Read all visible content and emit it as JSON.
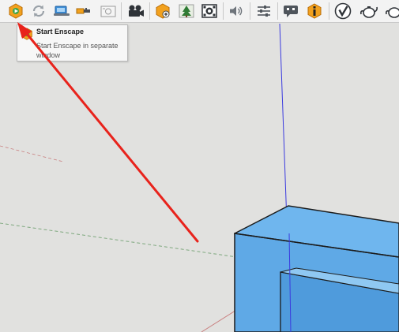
{
  "toolbar": {
    "buttons": [
      {
        "id": "start-enscape",
        "icon": "enscape-start-icon"
      },
      {
        "id": "sync-updates",
        "icon": "sync-icon"
      },
      {
        "id": "capture-screenshot",
        "icon": "screenshot-icon"
      },
      {
        "id": "export",
        "icon": "export-icon"
      },
      {
        "id": "render-image",
        "icon": "camera-icon"
      },
      {
        "id": "video-editor",
        "icon": "film-camera-icon"
      },
      {
        "id": "asset-library",
        "icon": "asset-library-icon"
      },
      {
        "id": "visual-settings",
        "icon": "tree-icon"
      },
      {
        "id": "panorama",
        "icon": "panorama-icon"
      },
      {
        "id": "sound",
        "icon": "speaker-icon"
      },
      {
        "id": "settings",
        "icon": "sliders-icon"
      },
      {
        "id": "feedback",
        "icon": "feedback-icon"
      },
      {
        "id": "about",
        "icon": "info-icon"
      },
      {
        "id": "vray-render",
        "icon": "vray-icon"
      },
      {
        "id": "teapot-render",
        "icon": "teapot-icon"
      },
      {
        "id": "teapot-render-2",
        "icon": "teapot-icon"
      }
    ]
  },
  "tooltip": {
    "title": "Start Enscape",
    "description": "Start Enscape in separate window"
  },
  "colors": {
    "toolbar_bg": "#f3f3f3",
    "viewport_bg": "#e1e1df",
    "blue_axis": "#3a3adf",
    "green_axis": "#7ea87e",
    "red_axis": "#c98080",
    "box_fill": "#5fa9e6",
    "box_top": "#6fb6ee",
    "annotation_arrow": "#e8231c",
    "enscape_orange": "#f2a11e"
  }
}
